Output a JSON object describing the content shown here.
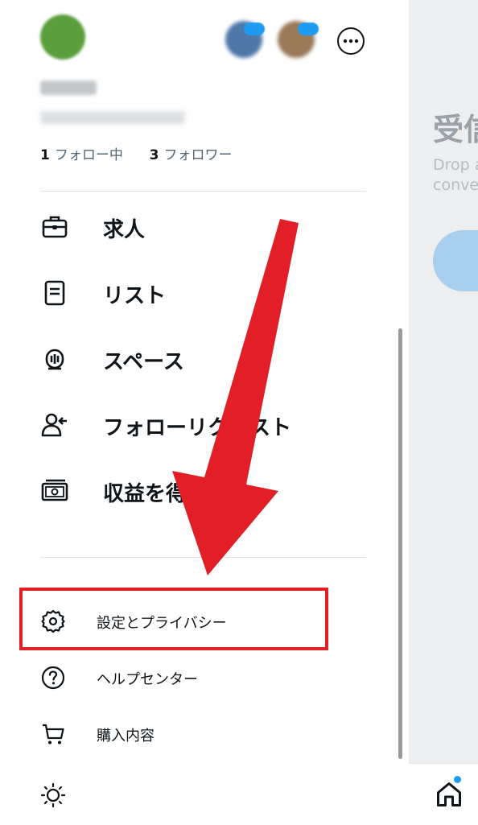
{
  "profile": {
    "following_count": "1",
    "following_label": "フォロー中",
    "followers_count": "3",
    "followers_label": "フォロワー"
  },
  "menu": {
    "items": [
      {
        "label": "求人",
        "icon": "briefcase-icon"
      },
      {
        "label": "リスト",
        "icon": "list-icon"
      },
      {
        "label": "スペース",
        "icon": "spaces-icon"
      },
      {
        "label": "フォローリクエスト",
        "icon": "follow-request-icon"
      },
      {
        "label": "収益を得る",
        "icon": "monetization-icon"
      }
    ]
  },
  "secondary": {
    "items": [
      {
        "label": "設定とプライバシー",
        "icon": "gear-icon"
      },
      {
        "label": "ヘルプセンター",
        "icon": "help-icon"
      },
      {
        "label": "購入内容",
        "icon": "cart-icon"
      }
    ]
  },
  "display_toggle": {
    "icon": "sun-icon"
  },
  "background": {
    "title": "受信",
    "subtitle_line1": "Drop a",
    "subtitle_line2": "conve"
  },
  "bottom_nav": {
    "icon": "home-icon"
  },
  "colors": {
    "annotation_red": "#e21f26",
    "accent_blue": "#1d9bf0",
    "text": "#0f1419",
    "secondary_text": "#536471"
  }
}
